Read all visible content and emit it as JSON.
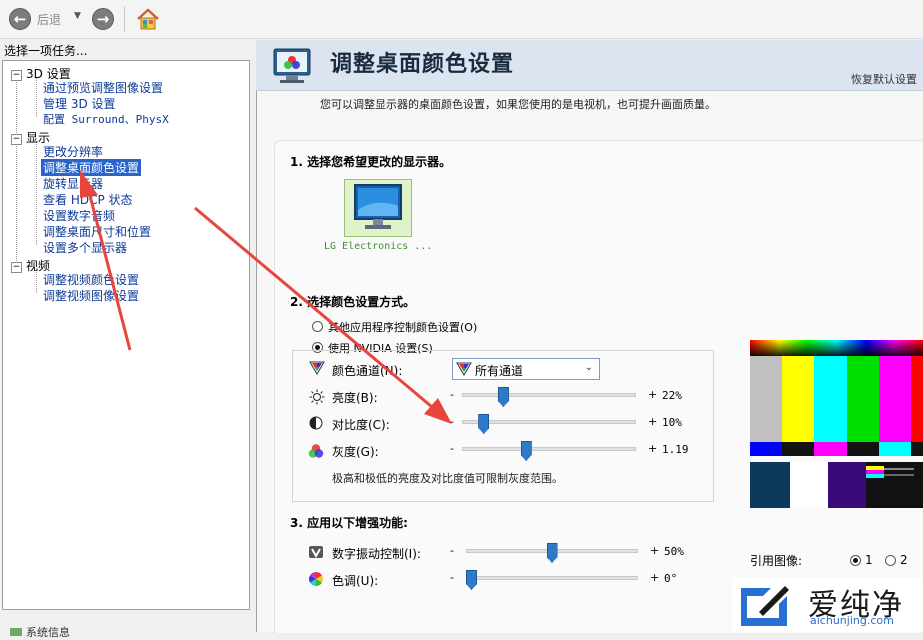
{
  "toolbar": {
    "back_label": "后退"
  },
  "sidebar": {
    "header": "选择一项任务...",
    "categories": [
      {
        "label": "3D 设置"
      },
      {
        "label": "显示"
      },
      {
        "label": "视频"
      }
    ],
    "items": [
      {
        "label": "通过预览调整图像设置"
      },
      {
        "label": "管理 3D 设置"
      },
      {
        "label": "配置 Surround、PhysX"
      },
      {
        "label": "更改分辨率"
      },
      {
        "label": "调整桌面颜色设置"
      },
      {
        "label": "旋转显示器"
      },
      {
        "label": "查看 HDCP 状态"
      },
      {
        "label": "设置数字音频"
      },
      {
        "label": "调整桌面尺寸和位置"
      },
      {
        "label": "设置多个显示器"
      },
      {
        "label": "调整视频颜色设置"
      },
      {
        "label": "调整视频图像设置"
      }
    ],
    "bottom_text": "系统信息"
  },
  "main": {
    "title": "调整桌面颜色设置",
    "restore_defaults": "恢复默认设置",
    "description": "您可以调整显示器的桌面颜色设置，如果您使用的是电视机，也可提升画面质量。",
    "section1_title": "1.  选择您希望更改的显示器。",
    "monitor_label": "LG Electronics ...",
    "section2_title": "2.  选择颜色设置方式。",
    "radio_other": "其他应用程序控制颜色设置(O)",
    "radio_nvidia": "使用 NVIDIA 设置(S)",
    "channel_label": "颜色通道(N):",
    "channel_value": "所有通道",
    "brightness": {
      "label": "亮度(B):",
      "value": "22%",
      "level": 0.22
    },
    "contrast": {
      "label": "对比度(C):",
      "value": "10%",
      "level": 0.1
    },
    "gamma": {
      "label": "灰度(G):",
      "value": "1.19",
      "level": 0.36
    },
    "hint": "极高和极低的亮度及对比度值可限制灰度范围。",
    "section3_title": "3.  应用以下增强功能:",
    "vibrance": {
      "label": "数字振动控制(I):",
      "value": "50%",
      "level": 0.5
    },
    "hue": {
      "label": "色调(U):",
      "value": "0°",
      "level": 0.0
    },
    "minus": "-",
    "plus": "+",
    "reference_label": "引用图像:",
    "ref_1": "1",
    "ref_2": "2"
  },
  "watermark": {
    "text": "爱纯净",
    "sub": "aichunjing.com"
  },
  "colors": {
    "selection": "#2a63c9",
    "arrow": "#e8453c",
    "slider": "#2f79c9"
  }
}
